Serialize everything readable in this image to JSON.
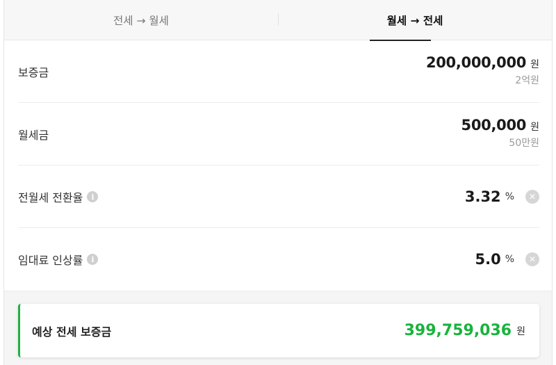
{
  "tabs": {
    "jeonse_to_wolse": "전세 → 월세",
    "wolse_to_jeonse": "월세 → 전세",
    "active": "wolse_to_jeonse"
  },
  "fields": {
    "deposit": {
      "label": "보증금",
      "value": "200,000,000",
      "unit": "원",
      "sub": "2억원"
    },
    "monthly_rent": {
      "label": "월세금",
      "value": "500,000",
      "unit": "원",
      "sub": "50만원"
    },
    "conversion_rate": {
      "label": "전월세 전환율",
      "value": "3.32",
      "unit": "%"
    },
    "rent_increase_rate": {
      "label": "임대료 인상률",
      "value": "5.0",
      "unit": "%"
    }
  },
  "result": {
    "label": "예상 전세 보증금",
    "value": "399,759,036",
    "unit": "원"
  },
  "icons": {
    "info": "i",
    "clear": "✕"
  },
  "colors": {
    "accent_green": "#19b33d",
    "active_tab_underline": "#222222"
  }
}
